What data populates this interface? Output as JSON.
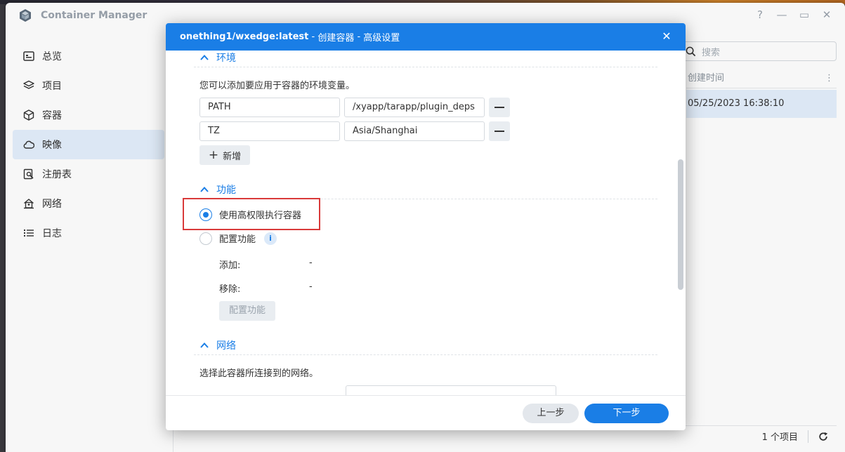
{
  "app": {
    "title": "Container Manager",
    "window_controls": [
      "?",
      "—",
      "▭",
      "✕"
    ]
  },
  "sidebar": {
    "items": [
      {
        "label": "总览",
        "icon": "overview-icon",
        "active": false
      },
      {
        "label": "项目",
        "icon": "layers-icon",
        "active": false
      },
      {
        "label": "容器",
        "icon": "cube-icon",
        "active": false
      },
      {
        "label": "映像",
        "icon": "cloud-icon",
        "active": true
      },
      {
        "label": "注册表",
        "icon": "registry-icon",
        "active": false
      },
      {
        "label": "网络",
        "icon": "network-icon",
        "active": false
      },
      {
        "label": "日志",
        "icon": "list-icon",
        "active": false
      }
    ]
  },
  "list": {
    "search_placeholder": "搜索",
    "column_header": "创建时间",
    "selected_row_time": "05/25/2023 16:38:10",
    "item_count": "1 个项目"
  },
  "modal": {
    "title_main": "onething1/wxedge:latest",
    "title_sep1": " - ",
    "title_step": "创建容器",
    "title_sep2": " - ",
    "title_page": "高级设置",
    "env": {
      "heading": "环境",
      "description": "您可以添加要应用于容器的环境变量。",
      "vars": [
        {
          "key": "PATH",
          "value": "/xyapp/tarapp/plugin_deps"
        },
        {
          "key": "TZ",
          "value": "Asia/Shanghai"
        }
      ],
      "add_label": "新增"
    },
    "capabilities": {
      "heading": "功能",
      "privileged_label": "使用高权限执行容器",
      "privileged_selected": true,
      "configure_label": "配置功能",
      "configure_selected": false,
      "add_label": "添加:",
      "add_value": "-",
      "remove_label": "移除:",
      "remove_value": "-",
      "configure_button": "配置功能"
    },
    "network": {
      "heading": "网络",
      "description": "选择此容器所连接到的网络。"
    },
    "buttons": {
      "prev": "上一步",
      "next": "下一步"
    }
  },
  "colors": {
    "accent": "#1a7ee6",
    "highlight_border": "#d93a3a",
    "selection_bg": "#e4effc"
  }
}
